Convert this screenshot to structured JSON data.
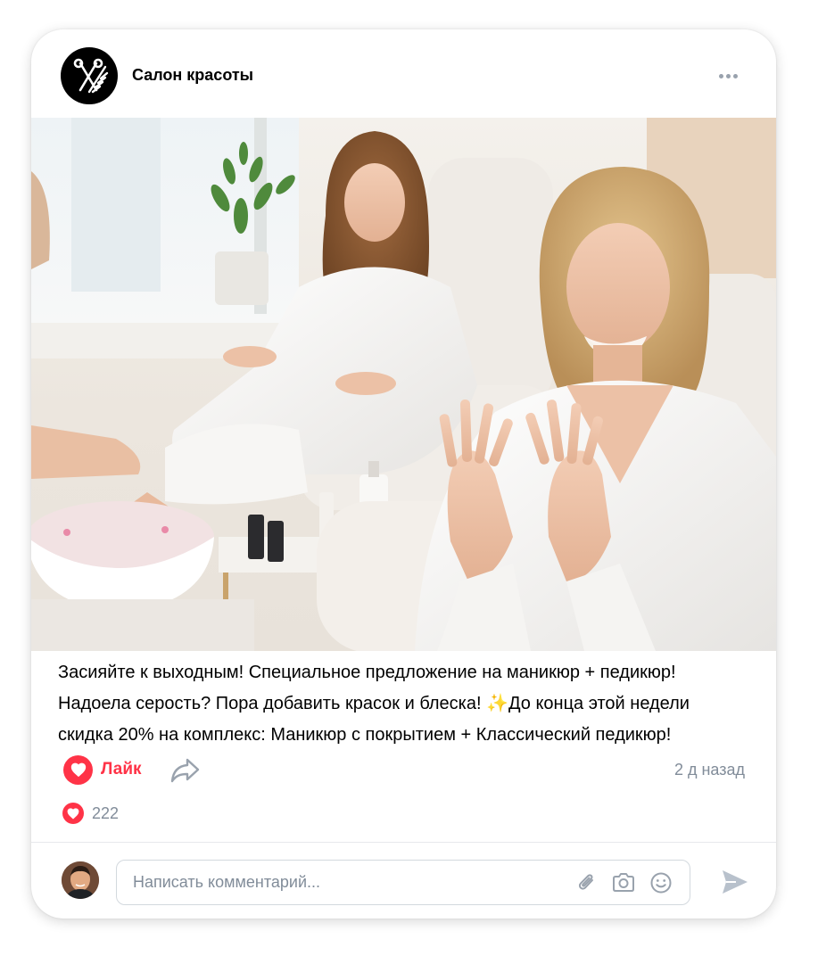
{
  "post": {
    "author": "Салон красоты",
    "text_lines": [
      "Засияйте к выходным! Специальное предложение на маникюр + педикюр!",
      "Надоела серость? Пора добавить красок и блеска! ✨До конца этой недели",
      "скидка 20% на комплекс: Маникюр с покрытием  + Классический педикюр!"
    ],
    "time": "2 д назад"
  },
  "actions": {
    "like_label": "Лайк",
    "likes_count": "222"
  },
  "comment": {
    "placeholder": "Написать комментарий..."
  },
  "icons": {
    "author_avatar": "scissors-comb-icon",
    "more": "more-horizontal-icon",
    "like": "heart-icon",
    "share": "share-arrow-icon",
    "attach": "paperclip-icon",
    "camera": "camera-icon",
    "emoji": "smile-icon",
    "send": "send-icon"
  },
  "colors": {
    "accent_red": "#ff3347",
    "secondary_text": "#818c99",
    "icon_gray": "#99a2ad"
  }
}
